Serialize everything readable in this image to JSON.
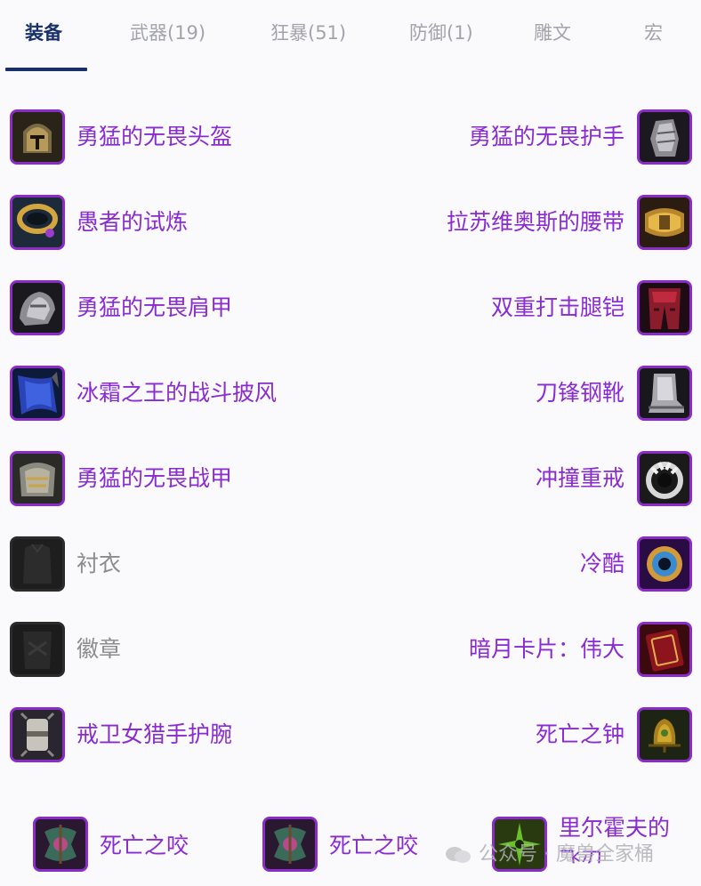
{
  "tabs": [
    {
      "label": "装备",
      "active": true
    },
    {
      "label": "武器(19)"
    },
    {
      "label": "狂暴(51)"
    },
    {
      "label": "防御(1)"
    },
    {
      "label": "雕文"
    },
    {
      "label": "宏"
    }
  ],
  "left_slots": [
    {
      "name": "勇猛的无畏头盔",
      "icon": "helmet-icon"
    },
    {
      "name": "愚者的试炼",
      "icon": "amulet-icon"
    },
    {
      "name": "勇猛的无畏肩甲",
      "icon": "shoulder-icon"
    },
    {
      "name": "冰霜之王的战斗披风",
      "icon": "cloak-icon"
    },
    {
      "name": "勇猛的无畏战甲",
      "icon": "chest-icon"
    },
    {
      "name": "衬衣",
      "icon": "shirt-slot-icon",
      "empty": true
    },
    {
      "name": "徽章",
      "icon": "tabard-slot-icon",
      "empty": true
    },
    {
      "name": "戒卫女猎手护腕",
      "icon": "bracer-icon"
    }
  ],
  "right_slots": [
    {
      "name": "勇猛的无畏护手",
      "icon": "gauntlet-icon"
    },
    {
      "name": "拉苏维奥斯的腰带",
      "icon": "belt-icon"
    },
    {
      "name": "双重打击腿铠",
      "icon": "legs-icon"
    },
    {
      "name": "刀锋钢靴",
      "icon": "boots-icon"
    },
    {
      "name": "冲撞重戒",
      "icon": "ring-icon"
    },
    {
      "name": "冷酷",
      "icon": "ring-eye-icon"
    },
    {
      "name": "暗月卡片：伟大",
      "icon": "card-icon"
    },
    {
      "name": "死亡之钟",
      "icon": "bell-icon"
    }
  ],
  "weapons": [
    {
      "name": "死亡之咬",
      "icon": "axe-icon"
    },
    {
      "name": "死亡之咬",
      "icon": "axe-icon"
    },
    {
      "name_line1": "里尔霍夫的",
      "name_line2": "飞刃",
      "icon": "shuriken-icon"
    }
  ],
  "watermark": "公众号 · 魔兽全家桶",
  "colors": {
    "accent": "#8a2bd0",
    "tab_active": "#17306a",
    "tab_inactive": "#a3a3ab",
    "empty_text": "#8c8c8c"
  }
}
